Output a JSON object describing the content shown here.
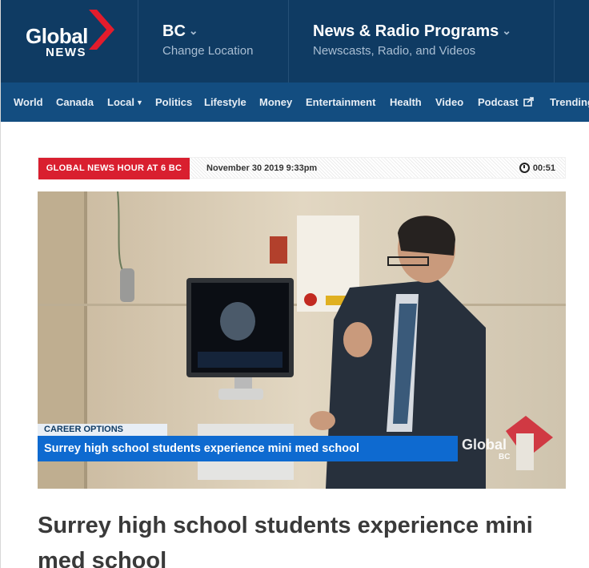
{
  "header": {
    "logo_top": "Global",
    "logo_bottom": "NEWS",
    "location_title": "BC",
    "location_sub": "Change Location",
    "programs_title": "News & Radio Programs",
    "programs_sub": "Newscasts, Radio, and Videos"
  },
  "nav": {
    "items": [
      "World",
      "Canada",
      "Local",
      "Politics",
      "Lifestyle",
      "Money",
      "Entertainment",
      "Health",
      "Video",
      "Podcast",
      "Trending"
    ]
  },
  "meta": {
    "show": "GLOBAL NEWS HOUR AT 6 BC",
    "date": "November 30 2019 9:33pm",
    "duration": "00:51"
  },
  "video": {
    "lower_third_tag": "CAREER OPTIONS",
    "lower_third_headline": "Surrey high school students experience mini med school",
    "watermark": "Global",
    "watermark_region": "BC"
  },
  "article": {
    "title": "Surrey high school students experience mini med school"
  },
  "colors": {
    "header_bg": "#0f3b63",
    "nav_bg": "#134d80",
    "badge_red": "#d91f2f",
    "lower_third_blue": "#0e6ad0"
  }
}
